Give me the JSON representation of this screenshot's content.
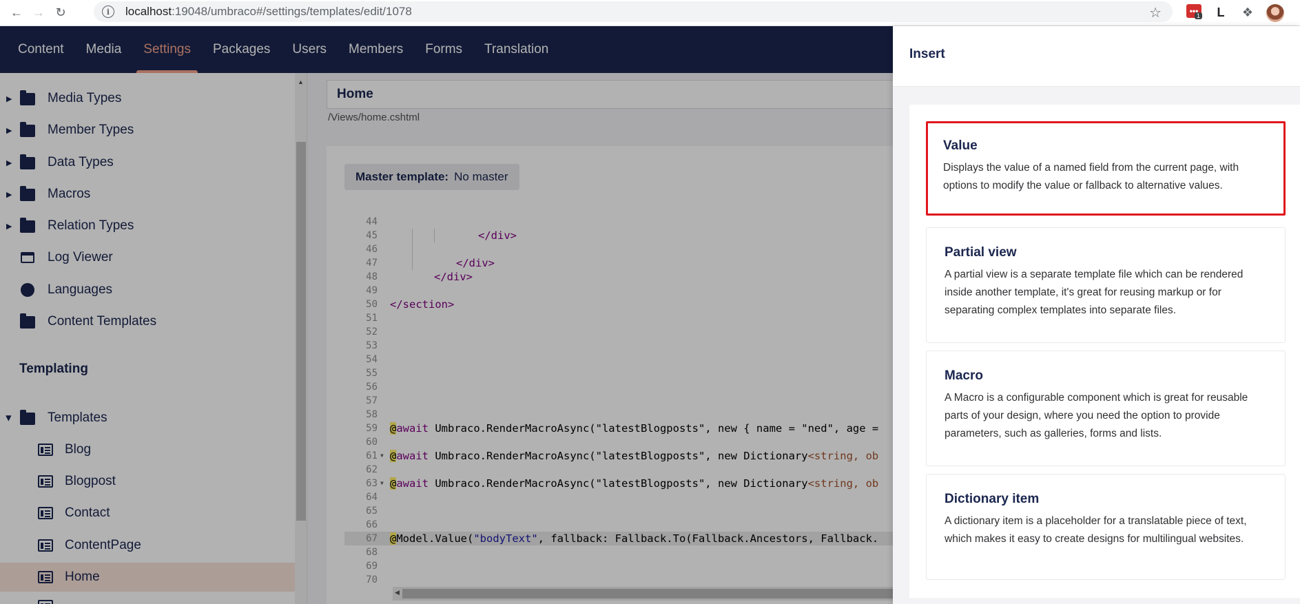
{
  "browser": {
    "url_host": "localhost",
    "url_rest": ":19048/umbraco#/settings/templates/edit/1078",
    "ext_badge": "1",
    "ext_letter": "L"
  },
  "header": {
    "tabs": [
      {
        "label": "Content"
      },
      {
        "label": "Media"
      },
      {
        "label": "Settings"
      },
      {
        "label": "Packages"
      },
      {
        "label": "Users"
      },
      {
        "label": "Members"
      },
      {
        "label": "Forms"
      },
      {
        "label": "Translation"
      }
    ],
    "active_tab": "Settings"
  },
  "sidebar": {
    "items": [
      {
        "label": "Media Types"
      },
      {
        "label": "Member Types"
      },
      {
        "label": "Data Types"
      },
      {
        "label": "Macros"
      },
      {
        "label": "Relation Types"
      },
      {
        "label": "Log Viewer"
      },
      {
        "label": "Languages"
      },
      {
        "label": "Content Templates"
      }
    ],
    "section_heading": "Templating",
    "templates_root": "Templates",
    "templates": [
      {
        "label": "Blog"
      },
      {
        "label": "Blogpost"
      },
      {
        "label": "Contact"
      },
      {
        "label": "ContentPage"
      },
      {
        "label": "Home"
      }
    ]
  },
  "editor": {
    "name": "Home",
    "path": "/Views/home.cshtml",
    "master_label": "Master template:",
    "master_value": "No master",
    "lines": [
      {
        "n": "44",
        "text": ""
      },
      {
        "n": "45",
        "text": "</div>"
      },
      {
        "n": "46",
        "text": ""
      },
      {
        "n": "47",
        "text": "</div>"
      },
      {
        "n": "48",
        "text": "</div>"
      },
      {
        "n": "49",
        "text": ""
      },
      {
        "n": "50",
        "text": "</section>"
      },
      {
        "n": "51",
        "text": ""
      },
      {
        "n": "52",
        "text": ""
      },
      {
        "n": "53",
        "text": ""
      },
      {
        "n": "54",
        "text": ""
      },
      {
        "n": "55",
        "text": ""
      },
      {
        "n": "56",
        "text": ""
      },
      {
        "n": "57",
        "text": ""
      },
      {
        "n": "58",
        "text": ""
      },
      {
        "n": "59",
        "at": "@",
        "kw": "await",
        "rest": " Umbraco.RenderMacroAsync(\"latestBlogposts\", new { name = \"ned\", age ="
      },
      {
        "n": "60",
        "text": ""
      },
      {
        "n": "61",
        "at": "@",
        "kw": "await",
        "rest": " Umbraco.RenderMacroAsync(\"latestBlogposts\", new Dictionary",
        "gen": "<string, ob"
      },
      {
        "n": "62",
        "text": ""
      },
      {
        "n": "63",
        "at": "@",
        "kw": "await",
        "rest": " Umbraco.RenderMacroAsync(\"latestBlogposts\", new Dictionary",
        "gen": "<string, ob"
      },
      {
        "n": "64",
        "text": ""
      },
      {
        "n": "65",
        "text": ""
      },
      {
        "n": "66",
        "text": ""
      },
      {
        "n": "67",
        "at": "@",
        "pre": "Model.Value(",
        "str": "\"bodyText\"",
        "post": ", fallback: Fallback.To(Fallback.Ancestors, Fallback."
      },
      {
        "n": "68",
        "text": ""
      },
      {
        "n": "69",
        "text": ""
      },
      {
        "n": "70",
        "text": ""
      }
    ]
  },
  "insert": {
    "title": "Insert",
    "cards": [
      {
        "title": "Value",
        "desc": "Displays the value of a named field from the current page, with options to modify the value or fallback to alternative values."
      },
      {
        "title": "Partial view",
        "desc": "A partial view is a separate template file which can be rendered inside another template, it's great for reusing markup or for separating complex templates into separate files."
      },
      {
        "title": "Macro",
        "desc": "A Macro is a configurable component which is great for reusable parts of your design, where you need the option to provide parameters, such as galleries, forms and lists."
      },
      {
        "title": "Dictionary item",
        "desc": "A dictionary item is a placeholder for a translatable piece of text, which makes it easy to create designs for multilingual websites."
      }
    ]
  },
  "colors": {
    "header_bg": "#1b264f",
    "active_accent": "#f5a38a",
    "highlight_border": "#e0161c"
  }
}
